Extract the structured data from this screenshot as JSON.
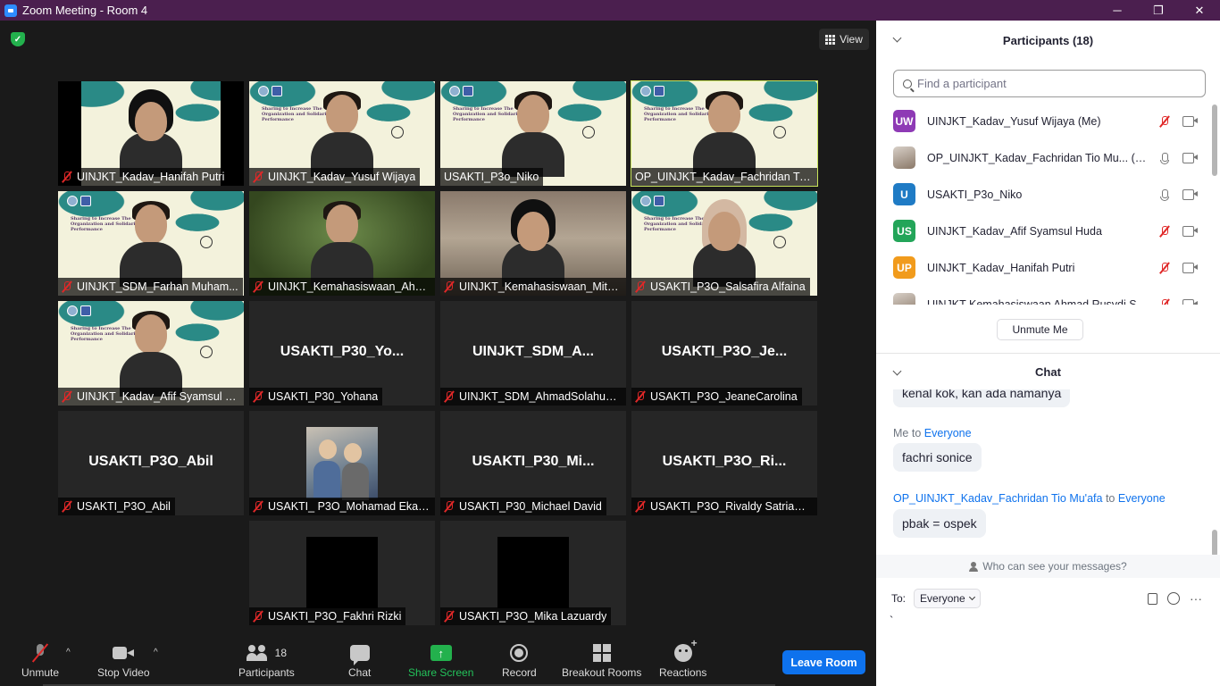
{
  "window": {
    "title": "Zoom Meeting - Room 4",
    "minimize": "─",
    "restore": "❐",
    "close": "✕"
  },
  "view_button": "View",
  "tiles": [
    {
      "name": "UINJKT_Kadav_Hanifah Putri",
      "muted": true
    },
    {
      "name": "UINJKT_Kadav_Yusuf Wijaya",
      "muted": true
    },
    {
      "name": "USAKTI_P3o_Niko",
      "muted": false
    },
    {
      "name": "OP_UINJKT_Kadav_Fachridan Tio ...",
      "muted": false,
      "active": true
    },
    {
      "name": "UINJKT_SDM_Farhan Muham...",
      "muted": true
    },
    {
      "name": "UINJKT_Kemahasiswaan_Ahm...",
      "muted": true
    },
    {
      "name": "UINJKT_Kemahasiswaan_Mith...",
      "muted": true
    },
    {
      "name": "USAKTI_P3O_Salsafira Alfaina",
      "muted": true
    },
    {
      "name": "UINJKT_Kadav_Afif Syamsul H...",
      "muted": true
    },
    {
      "name": "USAKTI_P30_Yohana",
      "muted": true,
      "big_label": "USAKTI_P30_Yo..."
    },
    {
      "name": "UINJKT_SDM_AhmadSolahudi...",
      "muted": true,
      "big_label": "UINJKT_SDM_A..."
    },
    {
      "name": "USAKTI_P3O_JeaneCarolina",
      "muted": true,
      "big_label": "USAKTI_P3O_Je..."
    },
    {
      "name": "USAKTI_P3O_Abil",
      "muted": true,
      "big_label": "USAKTI_P3O_Abil"
    },
    {
      "name": "USAKTI_ P3O_Mohamad Eka ...",
      "muted": true
    },
    {
      "name": "USAKTI_P30_Michael David",
      "muted": true,
      "big_label": "USAKTI_P30_Mi..."
    },
    {
      "name": "USAKTI_P3O_Rivaldy Satriawan",
      "muted": true,
      "big_label": "USAKTI_P3O_Ri..."
    },
    {
      "name": "USAKTI_P3O_Fakhri Rizki",
      "muted": true
    },
    {
      "name": "USAKTI_P3O_Mika Lazuardy",
      "muted": true
    }
  ],
  "slide_title": "Sharing to Increase The Organization and Solidarity Performance",
  "toolbar": {
    "unmute": "Unmute",
    "stop_video": "Stop Video",
    "participants": "Participants",
    "participants_count": "18",
    "chat": "Chat",
    "share_screen": "Share Screen",
    "share_arrow": "↑",
    "record": "Record",
    "breakout": "Breakout Rooms",
    "reactions": "Reactions",
    "leave": "Leave Room",
    "caret": "^"
  },
  "panel": {
    "participants_title": "Participants (18)",
    "search_placeholder": "Find a participant",
    "participants": [
      {
        "initials": "UW",
        "color": "#8e3ab5",
        "name": "UINJKT_Kadav_Yusuf Wijaya (Me)",
        "mic": "off"
      },
      {
        "initials": "",
        "photo": true,
        "name": "OP_UINJKT_Kadav_Fachridan Tio Mu... (Host)",
        "mic": "on"
      },
      {
        "initials": "U",
        "color": "#1f7bc5",
        "name": "USAKTI_P3o_Niko",
        "mic": "on"
      },
      {
        "initials": "US",
        "color": "#23a559",
        "name": "UINJKT_Kadav_Afif Syamsul Huda",
        "mic": "off"
      },
      {
        "initials": "UP",
        "color": "#f19b1c",
        "name": "UINJKT_Kadav_Hanifah Putri",
        "mic": "off"
      },
      {
        "initials": "",
        "photo": true,
        "name": "UINJKT Kemahasiswaan Ahmad Rusydi Said",
        "mic": "off"
      }
    ],
    "unmute_me": "Unmute Me",
    "chat_title": "Chat",
    "messages": [
      {
        "partial": true,
        "text": "kenal kok, kan ada namanya"
      },
      {
        "sender": "Me",
        "to": "Everyone",
        "text": "fachri sonice"
      },
      {
        "sender": "OP_UINJKT_Kadav_Fachridan Tio Mu'afa",
        "to": "Everyone",
        "text": "pbak = ospek"
      }
    ],
    "to_word": "to",
    "who_can_see": "Who can see your messages?",
    "to_label": "To:",
    "to_value": "Everyone",
    "more": "···",
    "input_value": "`"
  }
}
